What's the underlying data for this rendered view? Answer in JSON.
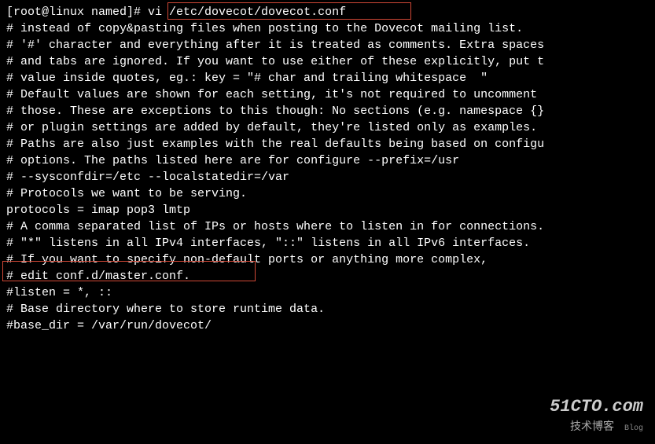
{
  "terminal": {
    "prompt": "[root@linux named]# ",
    "command": "vi /etc/dovecot/dovecot.conf",
    "lines": [
      "# instead of copy&pasting files when posting to the Dovecot mailing list.",
      "",
      "# '#' character and everything after it is treated as comments. Extra spaces",
      "# and tabs are ignored. If you want to use either of these explicitly, put t",
      "# value inside quotes, eg.: key = \"# char and trailing whitespace  \"",
      "",
      "# Default values are shown for each setting, it's not required to uncomment",
      "# those. These are exceptions to this though: No sections (e.g. namespace {}",
      "# or plugin settings are added by default, they're listed only as examples.",
      "# Paths are also just examples with the real defaults being based on configu",
      "# options. The paths listed here are for configure --prefix=/usr",
      "# --sysconfdir=/etc --localstatedir=/var",
      "",
      "# Protocols we want to be serving.",
      "protocols = imap pop3 lmtp",
      "",
      "# A comma separated list of IPs or hosts where to listen in for connections.",
      "# \"*\" listens in all IPv4 interfaces, \"::\" listens in all IPv6 interfaces.",
      "# If you want to specify non-default ports or anything more complex,",
      "# edit conf.d/master.conf.",
      "#listen = *, ::",
      "",
      "# Base directory where to store runtime data.",
      "#base_dir = /var/run/dovecot/"
    ]
  },
  "watermark": {
    "domain": "51CTO.com",
    "sub": "技术博客",
    "blog": "Blog"
  }
}
